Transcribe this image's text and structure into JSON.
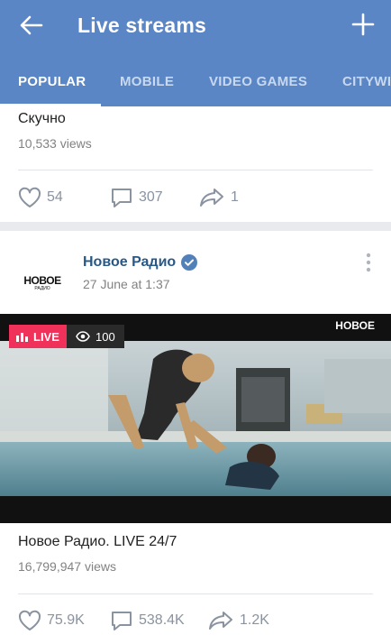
{
  "header": {
    "title": "Live streams",
    "tabs": [
      {
        "label": "POPULAR",
        "active": true
      },
      {
        "label": "MOBILE"
      },
      {
        "label": "VIDEO GAMES"
      },
      {
        "label": "CITYWI"
      }
    ]
  },
  "post1": {
    "title": "Скучно",
    "views": "10,533 views",
    "likes": "54",
    "comments": "307",
    "shares": "1"
  },
  "post2": {
    "channel": "Новое Радио",
    "date": "27 June at 1:37",
    "logo_text": "НОВОЕ",
    "logo_sub": "РАДИО",
    "live_label": "LIVE",
    "viewers": "100",
    "title": "Новое Радио. LIVE 24/7",
    "views": "16,799,947 views",
    "likes": "75.9K",
    "comments": "538.4K",
    "shares": "1.2K"
  },
  "colors": {
    "header": "#5b86c5",
    "live": "#f0315a",
    "link": "#2a5885"
  },
  "icons": [
    "back-arrow-icon",
    "plus-icon",
    "heart-icon",
    "comment-icon",
    "share-icon",
    "verified-icon",
    "more-vertical-icon",
    "eye-icon",
    "live-bars-icon"
  ]
}
